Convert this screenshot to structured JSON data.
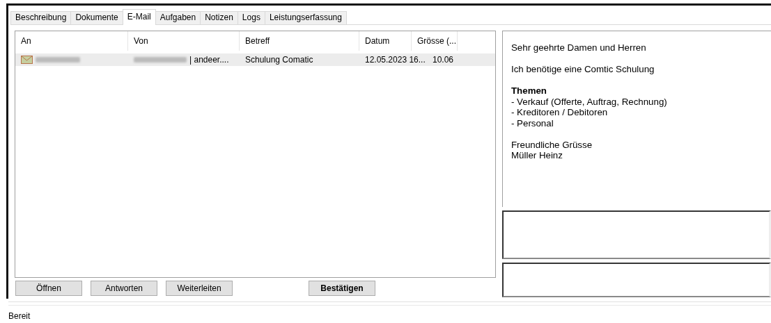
{
  "tabs": [
    {
      "label": "Beschreibung",
      "selected": false
    },
    {
      "label": "Dokumente",
      "selected": false
    },
    {
      "label": "E-Mail",
      "selected": true
    },
    {
      "label": "Aufgaben",
      "selected": false
    },
    {
      "label": "Notizen",
      "selected": false
    },
    {
      "label": "Logs",
      "selected": false
    },
    {
      "label": "Leistungserfassung",
      "selected": false
    }
  ],
  "table": {
    "columns": [
      "An",
      "Von",
      "Betreff",
      "Datum",
      "Grösse (..."
    ],
    "rows": [
      {
        "selected": true,
        "from_suffix": "| andeer....",
        "subject": "Schulung Comatic",
        "date": "12.05.2023 16...",
        "size": "10.06"
      }
    ]
  },
  "buttons": [
    {
      "label": "Öffnen",
      "kind": "normal"
    },
    {
      "label": "Antworten",
      "kind": "normal"
    },
    {
      "label": "Weiterleiten",
      "kind": "normal"
    },
    {
      "label": "Bestätigen",
      "kind": "primary"
    }
  ],
  "message": [
    {
      "kind": "text",
      "text": "Sehr geehrte Damen und Herren"
    },
    {
      "kind": "gap"
    },
    {
      "kind": "text",
      "text": "Ich benötige eine Comtic Schulung"
    },
    {
      "kind": "gap"
    },
    {
      "kind": "heading",
      "text": "Themen"
    },
    {
      "kind": "text",
      "text": "- Verkauf (Offerte, Auftrag, Rechnung)"
    },
    {
      "kind": "text",
      "text": "- Kreditoren / Debitoren"
    },
    {
      "kind": "text",
      "text": "- Personal"
    },
    {
      "kind": "gap"
    },
    {
      "kind": "text",
      "text": "Freundliche Grüsse"
    },
    {
      "kind": "text",
      "text": "Müller Heinz"
    }
  ],
  "status_bar": "Bereit"
}
